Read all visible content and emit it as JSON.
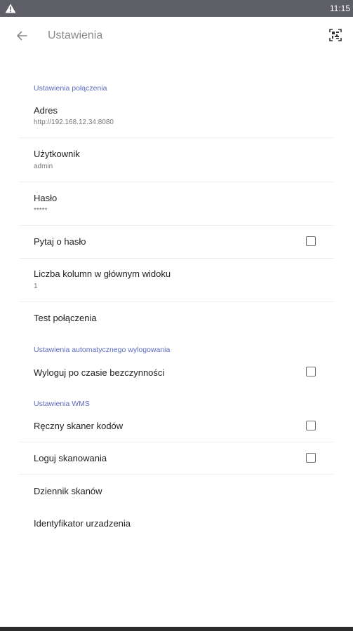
{
  "status_bar": {
    "time": "11:15",
    "warning_icon": "warning-icon"
  },
  "app_bar": {
    "title": "Ustawienia",
    "back_icon": "arrow-back-icon",
    "scan_icon": "scan-icon"
  },
  "sections": {
    "connection": {
      "header": "Ustawienia połączenia",
      "address": {
        "title": "Adres",
        "value": "http://192.168.12.34:8080"
      },
      "user": {
        "title": "Użytkownik",
        "value": "admin"
      },
      "password": {
        "title": "Hasło",
        "value": "*****"
      },
      "ask_password": {
        "title": "Pytaj o hasło",
        "checked": false
      },
      "columns": {
        "title": "Liczba kolumn w głównym widoku",
        "value": "1"
      },
      "test": {
        "title": "Test połączenia"
      }
    },
    "autologout": {
      "header": "Ustawienia automatycznego wylogowania",
      "logout_idle": {
        "title": "Wyloguj po czasie bezczynności",
        "checked": false
      }
    },
    "wms": {
      "header": "Ustawienia WMS",
      "manual_scanner": {
        "title": "Ręczny skaner kodów",
        "checked": false
      },
      "log_scans": {
        "title": "Loguj skanowania",
        "checked": false
      },
      "scan_log": {
        "title": "Dziennik skanów"
      },
      "device_id": {
        "title": "Identyfikator urzadzenia"
      }
    }
  }
}
